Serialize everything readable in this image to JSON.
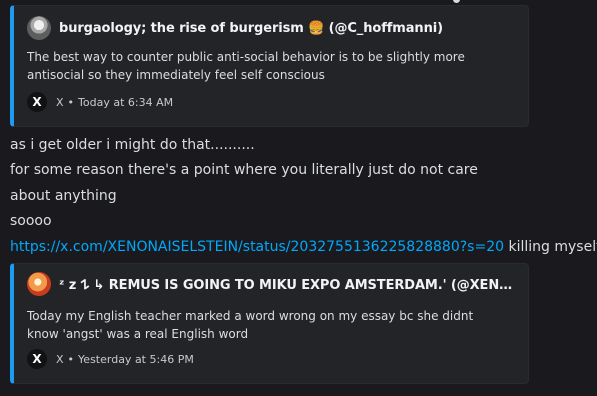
{
  "embed_1": {
    "author": "burgaology; the rise of burgerism 🍔 (@C_hoffmanni)",
    "description": "The best way to counter public anti-social behavior is to be slightly more antisocial so they immediately feel self conscious",
    "footer": {
      "icon": "x-logo-icon",
      "source": "X",
      "separator": "•",
      "timestamp": "Today at 6:34 AM"
    }
  },
  "message": {
    "lines": [
      "as i get older i might do that..........",
      "for some reason there's a point where you literally just do not care",
      "about anything",
      "soooo"
    ],
    "link": "https://x.com/XENONAISELSTEIN/status/2032755136225828880?s=20",
    "link_suffix": " killing myself"
  },
  "embed_2": {
    "author": "ᶻ z 𐰁 ↳ REMUS IS GOING TO MIKU EXPO AMSTERDAM.' (@XENONAISELSTEIN)",
    "description": "Today my English teacher marked a word wrong on my essay bc she didnt know 'angst' was a real English word",
    "footer": {
      "icon": "x-logo-icon",
      "source": "X",
      "separator": "•",
      "timestamp": "Yesterday at 5:46 PM"
    }
  },
  "colors": {
    "background": "#1a1a1e",
    "embed_background": "#232428",
    "embed_accent": "#1d9bf0",
    "link": "#00a8fc",
    "text": "#dbdee1"
  }
}
